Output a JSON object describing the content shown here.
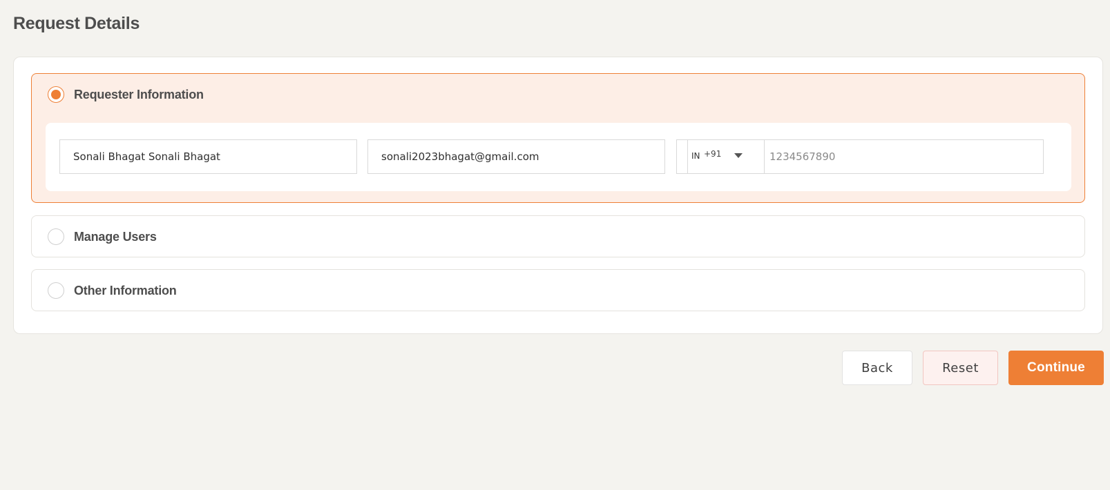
{
  "page": {
    "title": "Request Details"
  },
  "sections": [
    {
      "label": "Requester Information",
      "selected": true,
      "fields": {
        "name": {
          "value": "Sonali Bhagat Sonali Bhagat"
        },
        "email": {
          "value": "sonali2023bhagat@gmail.com"
        },
        "phone": {
          "country_code": "IN",
          "dial_code": "+91",
          "value": "",
          "placeholder": "1234567890"
        }
      }
    },
    {
      "label": "Manage Users",
      "selected": false
    },
    {
      "label": "Other Information",
      "selected": false
    }
  ],
  "actions": {
    "back_label": "Back",
    "reset_label": "Reset",
    "continue_label": "Continue"
  },
  "colors": {
    "accent": "#ee7f35",
    "active_section_bg": "#fdeee6",
    "page_bg": "#f4f3ef"
  }
}
